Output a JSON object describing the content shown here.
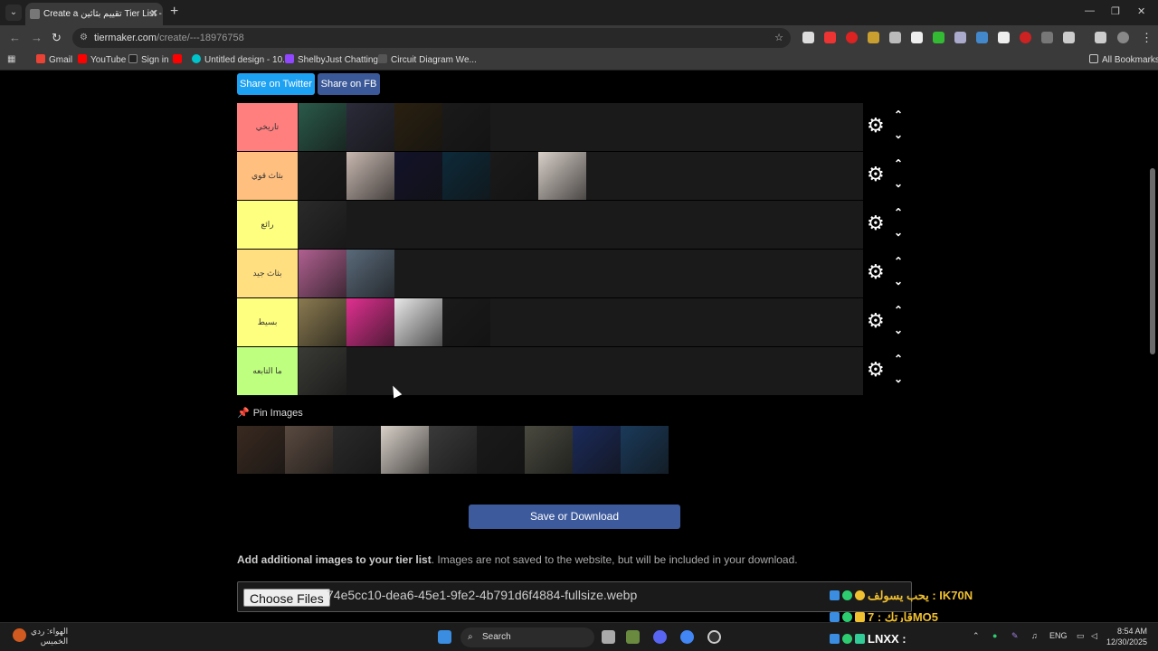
{
  "browser": {
    "tab_title": "Create a تقييم بثاثين Tier List - T",
    "url_host": "tiermaker.com",
    "url_path": "/create/---18976758",
    "bookmarks": [
      {
        "label": "Gmail",
        "color": "#ea4335"
      },
      {
        "label": "YouTube",
        "color": "#ff0000"
      },
      {
        "label": "Sign in",
        "color": "#222222"
      },
      {
        "label": "",
        "color": "#ff0000"
      },
      {
        "label": "Untitled design - 10...",
        "color": "#00c4cc"
      },
      {
        "label": "ShelbyJust Chatting...",
        "color": "#9146ff"
      },
      {
        "label": "Circuit Diagram We...",
        "color": "#444444"
      }
    ],
    "all_bookmarks": "All Bookmarks"
  },
  "page": {
    "share_twitter": "Share on Twitter",
    "share_fb": "Share on FB",
    "tiers": [
      {
        "label": "تاريخي",
        "color": "#ff7f7f",
        "items": [
          "#2a5a4a",
          "#2b2b3a",
          "#2a2010",
          "#1a1a1a"
        ]
      },
      {
        "label": "بثاث قوي",
        "color": "#ffbf7f",
        "items": [
          "#1c1c1c",
          "#c8b8b0",
          "#12122a",
          "#0d2a3a",
          "#1a1a1a",
          "#d8cfc8"
        ]
      },
      {
        "label": "رائع",
        "color": "#ffff7f",
        "items": [
          "#2a2a2a"
        ]
      },
      {
        "label": "بثاث جيد",
        "color": "#ffdf80",
        "items": [
          "#b06090",
          "#5a6a7a"
        ]
      },
      {
        "label": "بسيط",
        "color": "#ffff7f",
        "items": [
          "#8a7a50",
          "#e03090",
          "#e8e8e8",
          "#1a1a1a"
        ]
      },
      {
        "label": "ما التابعه",
        "color": "#bfff7f",
        "items": [
          "#3a3a36"
        ]
      }
    ],
    "pin_title": "Pin Images",
    "pin_images": [
      "#3a2a20",
      "#5a4a40",
      "#2a2a2a",
      "#d8d0c8",
      "#3a3a3a",
      "#1a1a1a",
      "#4a4a40",
      "#1a2a5a",
      "#1a3a5a"
    ],
    "save_button": "Save or Download",
    "add_bold": "Add additional images to your tier list",
    "add_rest": ". Images are not saved to the website, but will be included in your download.",
    "choose_files": "Choose Files",
    "file_name": "74e5cc10-dea6-45e1-9fe2-4b791d6f4884-fullsize.webp"
  },
  "chat": [
    {
      "text": "يحب يسولف : IK70N",
      "color": "#f0c030"
    },
    {
      "text": "قارتك : 7MO5",
      "color": "#f0c030"
    },
    {
      "text": "LNXX :",
      "color": "#ffffff"
    }
  ],
  "taskbar": {
    "weather_line1": "الهواء: ردي",
    "weather_line2": "الخميس",
    "search": "Search",
    "lang": "ENG",
    "time": "8:54 AM",
    "date": "12/30/2025"
  }
}
